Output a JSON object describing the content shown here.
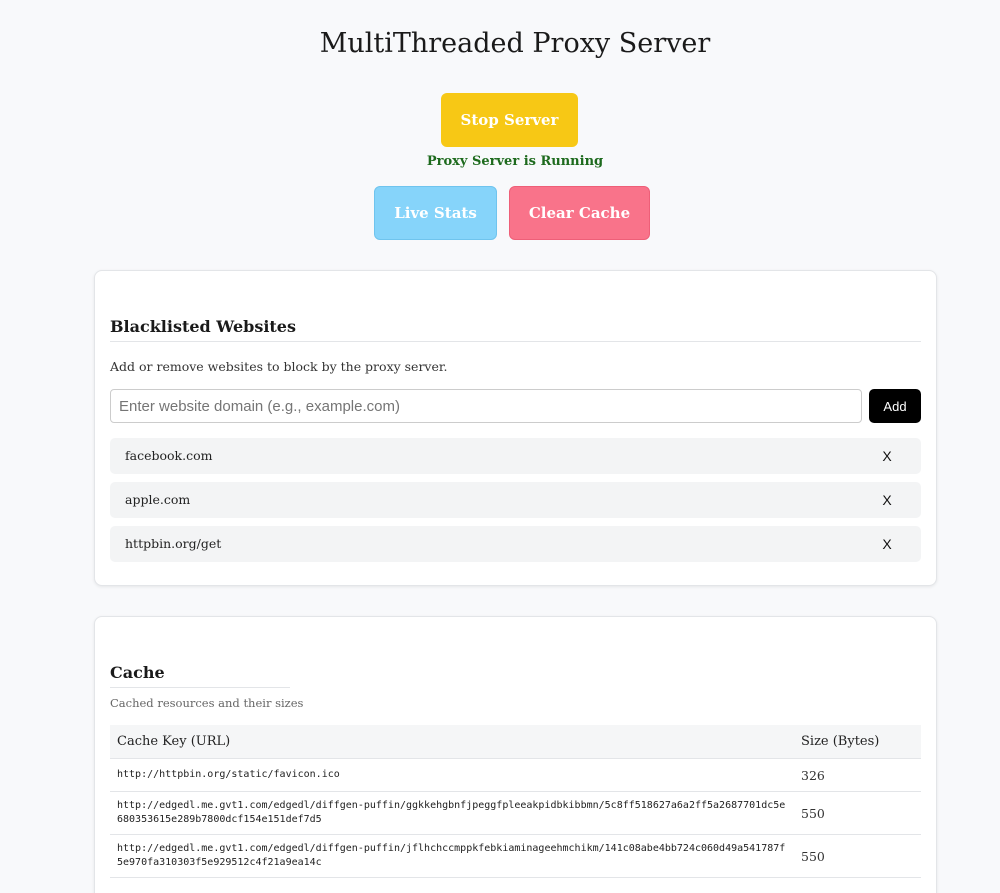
{
  "header": {
    "title": "MultiThreaded Proxy Server"
  },
  "controls": {
    "stop_label": "Stop Server",
    "status_text": "Proxy Server is Running",
    "stats_label": "Live Stats",
    "clear_label": "Clear Cache"
  },
  "blacklist": {
    "heading": "Blacklisted Websites",
    "description": "Add or remove websites to block by the proxy server.",
    "input_placeholder": "Enter website domain (e.g., example.com)",
    "add_label": "Add",
    "remove_label": "X",
    "items": [
      {
        "label": "facebook.com"
      },
      {
        "label": "apple.com"
      },
      {
        "label": "httpbin.org/get"
      }
    ]
  },
  "cache": {
    "heading": "Cache",
    "description": "Cached resources and their sizes",
    "columns": [
      "Cache Key (URL)",
      "Size (Bytes)"
    ],
    "rows": [
      {
        "url": "http://httpbin.org/static/favicon.ico",
        "size": "326"
      },
      {
        "url": "http://edgedl.me.gvt1.com/edgedl/diffgen-puffin/ggkkehgbnfjpeggfpleeakpidbkibbmn/5c8ff518627a6a2ff5a2687701dc5e680353615e289b7800dcf154e151def7d5",
        "size": "550"
      },
      {
        "url": "http://edgedl.me.gvt1.com/edgedl/diffgen-puffin/jflhchccmppkfebkiaminageehmchikm/141c08abe4bb724c060d49a541787f5e970fa310303f5e929512c4f21a9ea14c",
        "size": "550"
      }
    ]
  },
  "colors": {
    "stop_button": "#f7c815",
    "stats_button": "#86d4fa",
    "clear_button": "#f9738a",
    "status_text": "#1d6a1d",
    "add_button": "#000000"
  }
}
